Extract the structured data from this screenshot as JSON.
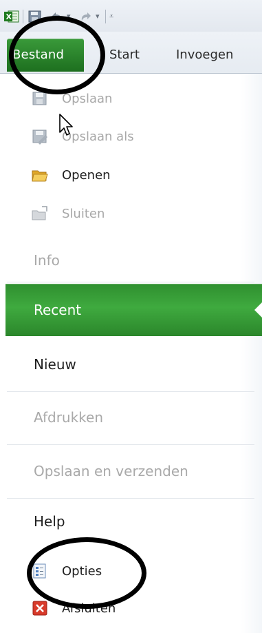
{
  "ribbon": {
    "file_tab": "Bestand",
    "tabs": [
      "Start",
      "Invoegen"
    ]
  },
  "backstage": {
    "commands": [
      {
        "label": "Opslaan",
        "enabled": false,
        "icon": "save-icon"
      },
      {
        "label": "Opslaan als",
        "enabled": false,
        "icon": "save-as-icon"
      },
      {
        "label": "Openen",
        "enabled": true,
        "icon": "open-folder-icon"
      },
      {
        "label": "Sluiten",
        "enabled": false,
        "icon": "close-folder-icon"
      }
    ],
    "categories": {
      "info": "Info",
      "recent": "Recent",
      "nieuw": "Nieuw",
      "afdrukken": "Afdrukken",
      "opslaan_verzenden": "Opslaan en verzenden",
      "help": "Help"
    },
    "bottom": [
      {
        "label": "Opties",
        "icon": "options-icon"
      },
      {
        "label": "Afsluiten",
        "icon": "exit-icon"
      }
    ]
  },
  "colors": {
    "file_tab": "#1d6f1f",
    "selected": "#3faa3f",
    "disabled_text": "#a8a8a8"
  }
}
